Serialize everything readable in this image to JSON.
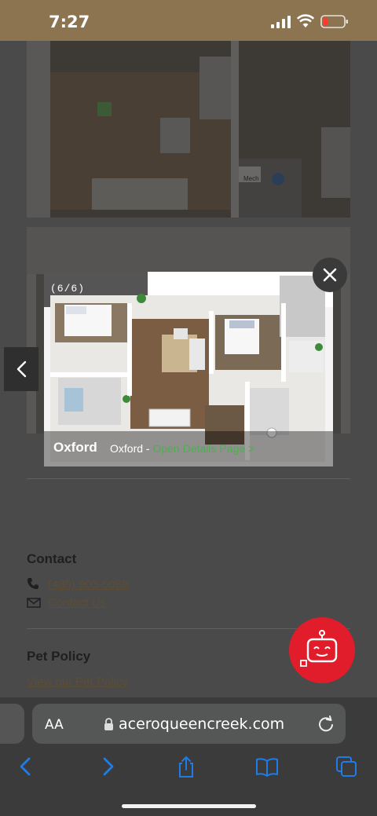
{
  "status_bar": {
    "time": "7:27"
  },
  "gallery": {
    "counter": "(6/6)",
    "caption_title": "Oxford",
    "caption_name": "Oxford - ",
    "caption_link": "Open Details Page",
    "caption_chevron": ">"
  },
  "closet_label": "Mech",
  "contact": {
    "heading": "Contact",
    "phone": "(480) 903-5080",
    "email_label": "Contact Us"
  },
  "pet_policy": {
    "heading": "Pet Policy",
    "link": "View our Pet Policy"
  },
  "browser": {
    "text_size_label": "AA",
    "url": "aceroqueencreek.com"
  },
  "colors": {
    "status_bar_bg": "#8c7451",
    "chat_button": "#e21d2b",
    "link_green": "#4caf50",
    "safari_blue": "#1e7be8"
  }
}
